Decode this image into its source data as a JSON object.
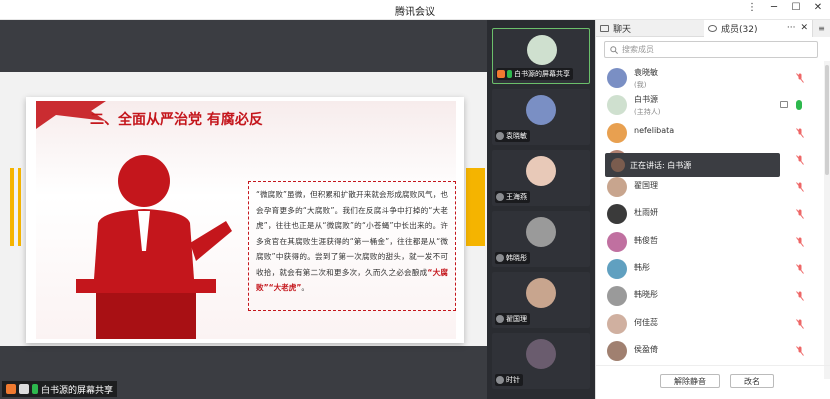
{
  "window": {
    "title": "腾讯会议",
    "controls": [
      "⋮",
      "─",
      "☐",
      "✕"
    ]
  },
  "slide": {
    "heading": "二、全面从严治党 有腐必反",
    "body": "“微腐败”虽微，但积累和扩散开来就会形成腐败风气，也会孕育更多的“大腐败”。我们在反腐斗争中打掉的“大老虎”，往往也正是从“微腐败”的“小苍蝇”中长出来的。许多贪官在其腐败生涯获得的“第一桶金”，往往都是从“微腐败”中获得的。尝到了第一次腐败的甜头，就一发不可收拾，就会有第二次和更多次，久而久之必会酿成",
    "highlight": "“大腐败”“大老虎”",
    "end": "。"
  },
  "share_label": "白书源的屏幕共享",
  "tiles": [
    {
      "name": "白书源的屏幕共享",
      "color": "#cfe0cf",
      "active": true
    },
    {
      "name": "袁晓敏",
      "color": "#7a8fc4"
    },
    {
      "name": "王海燕",
      "color": "#e8c9b8"
    },
    {
      "name": "韩晓彤",
      "color": "#9a9a9a"
    },
    {
      "name": "翟国理",
      "color": "#c8a58e"
    },
    {
      "name": "时针",
      "color": "#6a5c6e"
    }
  ],
  "panel": {
    "tab_chat": "聊天",
    "tab_members": "成员(32)",
    "tab_controls": [
      "···",
      "✕"
    ],
    "menu": "≡",
    "search_placeholder": "搜索成员",
    "speaking": "正在讲话: 白书源",
    "mute_all": "解除静音",
    "rename": "改名"
  },
  "members": [
    {
      "name": "袁晓敏",
      "sub": "(我)",
      "color": "#7a8fc4"
    },
    {
      "name": "白书源",
      "sub": "(主持人)",
      "color": "#cfe0cf",
      "host": true
    },
    {
      "name": "nefelibata",
      "color": "#e8a050"
    },
    {
      "name": "",
      "color": "#b08070"
    },
    {
      "name": "翟国理",
      "color": "#c8a58e"
    },
    {
      "name": "杜雨妍",
      "color": "#3a3a3a"
    },
    {
      "name": "韩俊哲",
      "color": "#c070a0"
    },
    {
      "name": "韩彤",
      "color": "#60a0c0"
    },
    {
      "name": "韩晓彤",
      "color": "#9a9a9a"
    },
    {
      "name": "何佳蕊",
      "color": "#d0b0a0"
    },
    {
      "name": "侯盈倚",
      "color": "#a08070"
    }
  ],
  "colors": {
    "accent": "#c4161c",
    "yellow": "#f5b400",
    "green": "#2db84d",
    "dark": "#3b3d42"
  }
}
